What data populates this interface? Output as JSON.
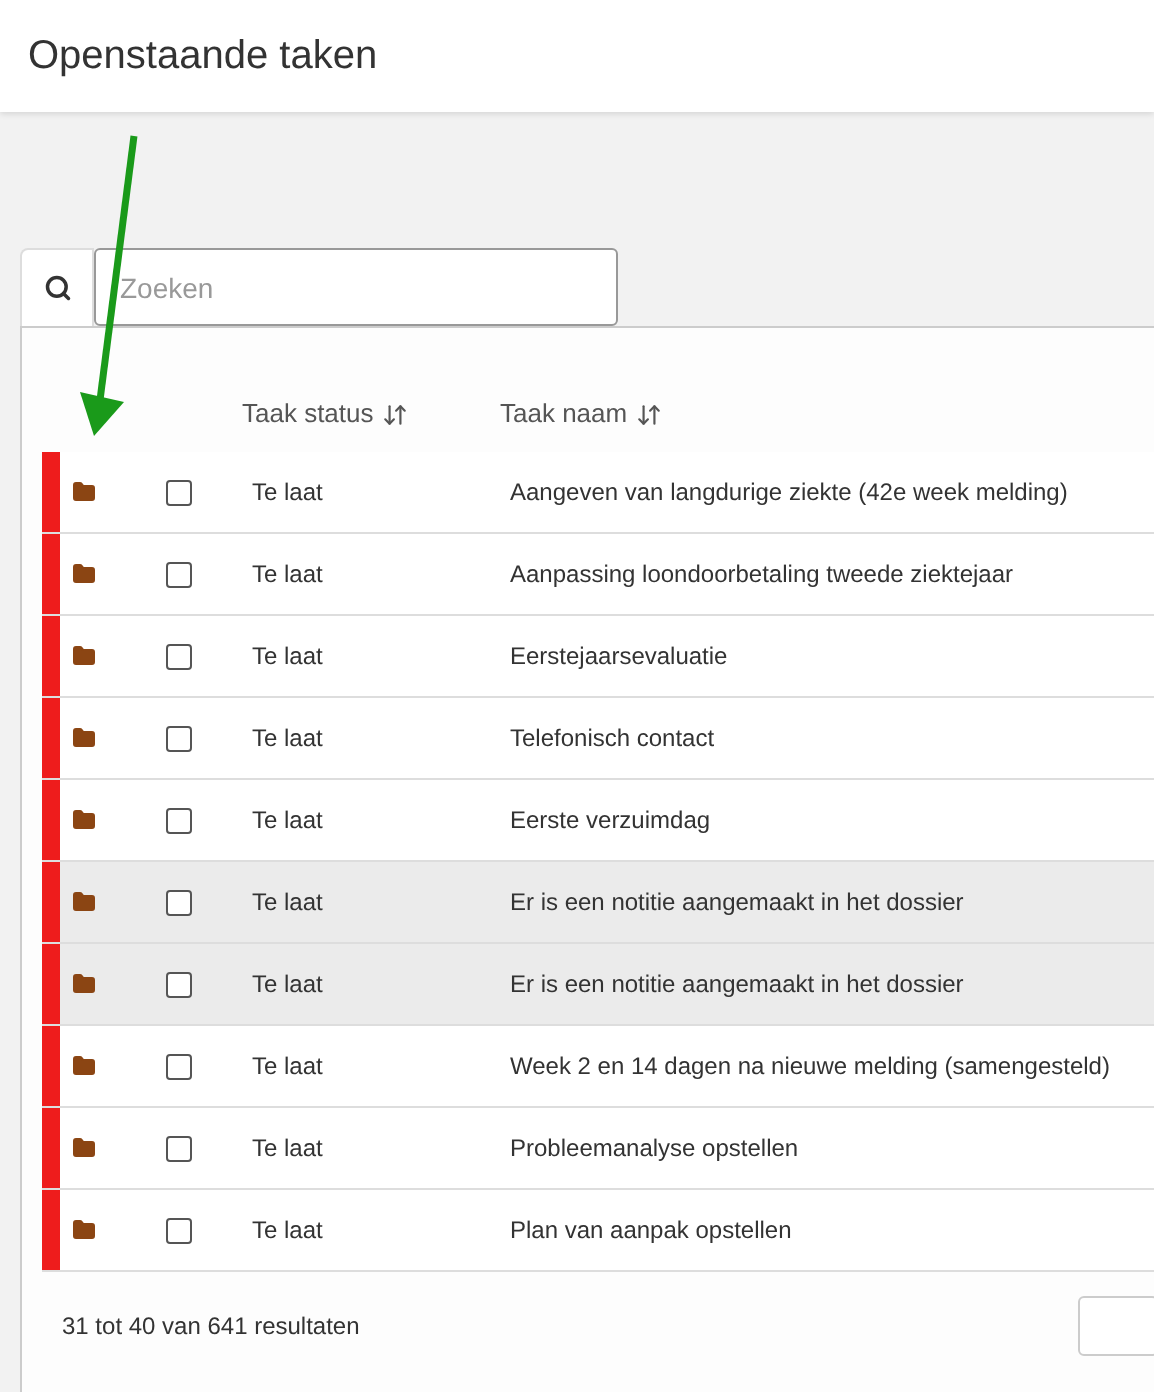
{
  "title": "Openstaande taken",
  "search": {
    "placeholder": "Zoeken"
  },
  "columns": [
    "Taak status",
    "Taak naam"
  ],
  "rows": [
    {
      "status": "Te laat",
      "name": "Aangeven van langdurige ziekte (42e week melding)",
      "color": "#ee1c1c",
      "checked": false,
      "highlighted": false
    },
    {
      "status": "Te laat",
      "name": "Aanpassing loondoorbetaling tweede ziektejaar",
      "color": "#ee1c1c",
      "checked": false,
      "highlighted": false
    },
    {
      "status": "Te laat",
      "name": "Eerstejaarsevaluatie",
      "color": "#ee1c1c",
      "checked": false,
      "highlighted": false
    },
    {
      "status": "Te laat",
      "name": "Telefonisch contact",
      "color": "#ee1c1c",
      "checked": false,
      "highlighted": false
    },
    {
      "status": "Te laat",
      "name": "Eerste verzuimdag",
      "color": "#ee1c1c",
      "checked": false,
      "highlighted": false
    },
    {
      "status": "Te laat",
      "name": "Er is een notitie aangemaakt in het dossier",
      "color": "#ee1c1c",
      "checked": false,
      "highlighted": true
    },
    {
      "status": "Te laat",
      "name": "Er is een notitie aangemaakt in het dossier",
      "color": "#ee1c1c",
      "checked": false,
      "highlighted": true
    },
    {
      "status": "Te laat",
      "name": "Week 2 en 14 dagen na nieuwe melding (samengesteld)",
      "color": "#ee1c1c",
      "checked": false,
      "highlighted": false
    },
    {
      "status": "Te laat",
      "name": "Probleemanalyse opstellen",
      "color": "#ee1c1c",
      "checked": false,
      "highlighted": false
    },
    {
      "status": "Te laat",
      "name": "Plan van aanpak opstellen",
      "color": "#ee1c1c",
      "checked": false,
      "highlighted": false
    }
  ],
  "footer": "31 tot 40 van 641 resultaten"
}
